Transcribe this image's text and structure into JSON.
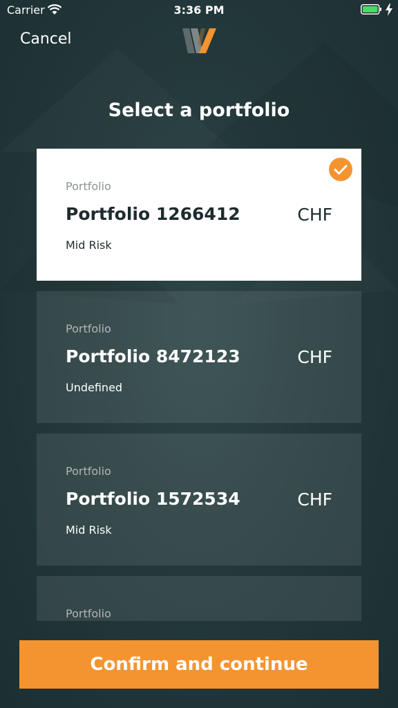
{
  "status_bar": {
    "carrier": "Carrier",
    "time": "3:36 PM"
  },
  "nav": {
    "cancel_label": "Cancel"
  },
  "page": {
    "title": "Select a portfolio"
  },
  "portfolios": [
    {
      "label": "Portfolio",
      "name": "Portfolio 1266412",
      "currency": "CHF",
      "risk": "Mid Risk",
      "selected": true
    },
    {
      "label": "Portfolio",
      "name": "Portfolio 8472123",
      "currency": "CHF",
      "risk": "Undefined",
      "selected": false
    },
    {
      "label": "Portfolio",
      "name": "Portfolio 1572534",
      "currency": "CHF",
      "risk": "Mid Risk",
      "selected": false
    },
    {
      "label": "Portfolio",
      "name": "",
      "currency": "",
      "risk": "",
      "selected": false
    }
  ],
  "footer": {
    "confirm_label": "Confirm and continue"
  },
  "colors": {
    "accent": "#f49431",
    "background": "#24393b",
    "card_selected": "#ffffff",
    "battery": "#4cd964"
  },
  "icons": {
    "wifi": "wifi-icon",
    "battery": "battery-icon",
    "check": "checkmark-icon",
    "logo": "w-logo-icon"
  }
}
